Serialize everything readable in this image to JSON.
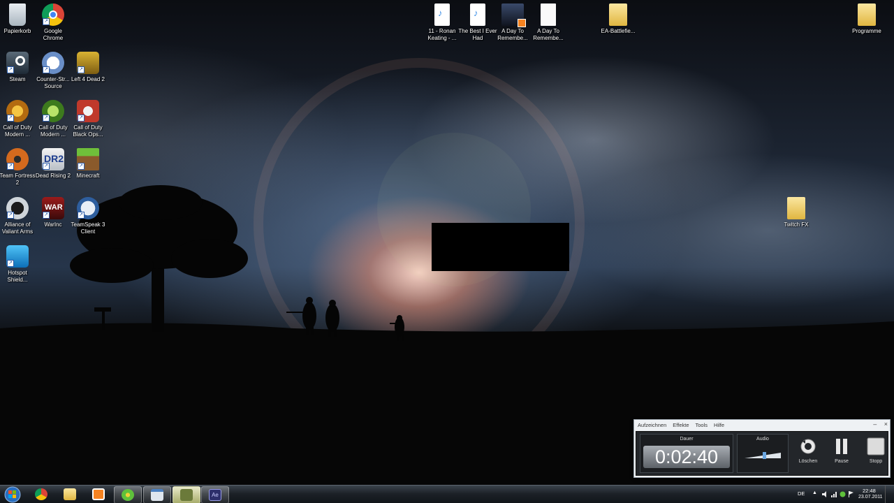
{
  "desktop": {
    "icons": [
      {
        "label": "Papierkorb",
        "icon": "recycle-bin-icon"
      },
      {
        "label": "Google Chrome",
        "icon": "chrome-icon"
      },
      {
        "label": "Steam",
        "icon": "steam-icon"
      },
      {
        "label": "Counter-Str... Source",
        "icon": "counter-strike-icon"
      },
      {
        "label": "Left 4 Dead 2",
        "icon": "left4dead-icon"
      },
      {
        "label": "Call of Duty Modern ...",
        "icon": "cod-mw-icon"
      },
      {
        "label": "Call of Duty Modern ...",
        "icon": "cod-mw2-icon"
      },
      {
        "label": "Call of Duty Black Ops...",
        "icon": "cod-blackops-icon"
      },
      {
        "label": "Team Fortress 2",
        "icon": "tf2-icon"
      },
      {
        "label": "Dead Rising 2",
        "icon": "deadrising-icon"
      },
      {
        "label": "Minecraft",
        "icon": "minecraft-icon"
      },
      {
        "label": "Alliance of Valiant Arms",
        "icon": "ava-icon"
      },
      {
        "label": "WarInc",
        "icon": "warinc-icon"
      },
      {
        "label": "TeamSpeak 3 Client",
        "icon": "teamspeak-icon"
      },
      {
        "label": "Hotspot Shield...",
        "icon": "hotspot-shield-icon"
      },
      {
        "label": "11 - Ronan Keating - ...",
        "icon": "audio-file-icon"
      },
      {
        "label": "The Best I Ever Had",
        "icon": "audio-file-icon"
      },
      {
        "label": "A Day To Remembe...",
        "icon": "video-thumb-icon"
      },
      {
        "label": "A Day To Remembe...",
        "icon": "blank-file-icon"
      },
      {
        "label": "EA-Battlefie...",
        "icon": "folder-icon"
      },
      {
        "label": "Programme",
        "icon": "folder-icon"
      },
      {
        "label": "Twitch FX",
        "icon": "folder-icon"
      }
    ]
  },
  "recorder": {
    "menu": [
      "Aufzeichnen",
      "Effekte",
      "Tools",
      "Hilfe"
    ],
    "window_buttons": [
      "–",
      "×"
    ],
    "duration_label": "Dauer",
    "duration_value": "0:02:40",
    "audio_label": "Audio",
    "audio_level": 0.55,
    "buttons": [
      {
        "label": "Löschen",
        "icon": "delete-reset-icon"
      },
      {
        "label": "Pause",
        "icon": "pause-icon"
      },
      {
        "label": "Stopp",
        "icon": "stop-icon"
      }
    ]
  },
  "taskbar": {
    "pinned": [
      {
        "icon": "chrome-icon",
        "color": "#e3a21a"
      },
      {
        "icon": "explorer-folder-icon",
        "color": "#f2c94c"
      },
      {
        "icon": "media-player-icon",
        "color": "#f58220"
      },
      {
        "icon": "icq-icon",
        "color": "#5fc13b"
      },
      {
        "icon": "notepad-icon",
        "color": "#dfe6ee"
      },
      {
        "icon": "recorder-app-icon",
        "color": "#9fb35a"
      },
      {
        "icon": "after-effects-icon",
        "color": "#2d2f6b"
      }
    ],
    "tray": {
      "language": "DE",
      "show_hidden": "▲",
      "time": "22:48",
      "date": "23.07.2011"
    }
  }
}
